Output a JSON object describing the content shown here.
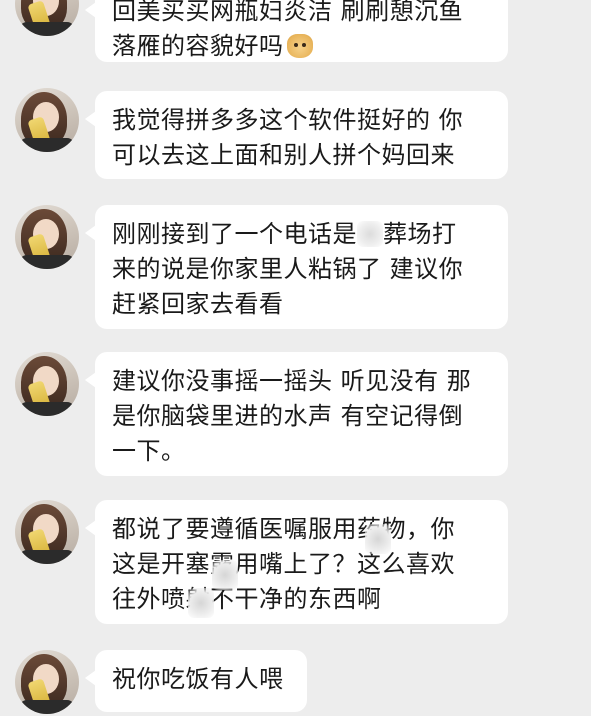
{
  "messages": [
    {
      "lines": [
        "回美买买网瓶妇炎洁 刷刷憩沉鱼",
        "落雁的容貌好吗"
      ],
      "emoji": "doge-emoji"
    },
    {
      "lines": [
        "我觉得拼多多这个软件挺好的 你",
        "可以去这上面和别人拼个妈回来"
      ]
    },
    {
      "lines_parts": [
        [
          "刚刚接到了一个电话是",
          "葬场打"
        ]
      ],
      "lines": [
        "来的说是你家里人粘锅了 建议你",
        "赶紧回家去看看"
      ]
    },
    {
      "lines": [
        "建议你没事摇一摇头 听见没有 那",
        "是你脑袋里进的水声 有空记得倒",
        "一下。"
      ]
    },
    {
      "lines": [
        "都说了要遵循医嘱服用药物，你",
        "这是开塞露用嘴上了？这么喜欢",
        "往外喷射不干净的东西啊"
      ]
    },
    {
      "lines": [
        "祝你吃饭有人喂"
      ]
    }
  ]
}
